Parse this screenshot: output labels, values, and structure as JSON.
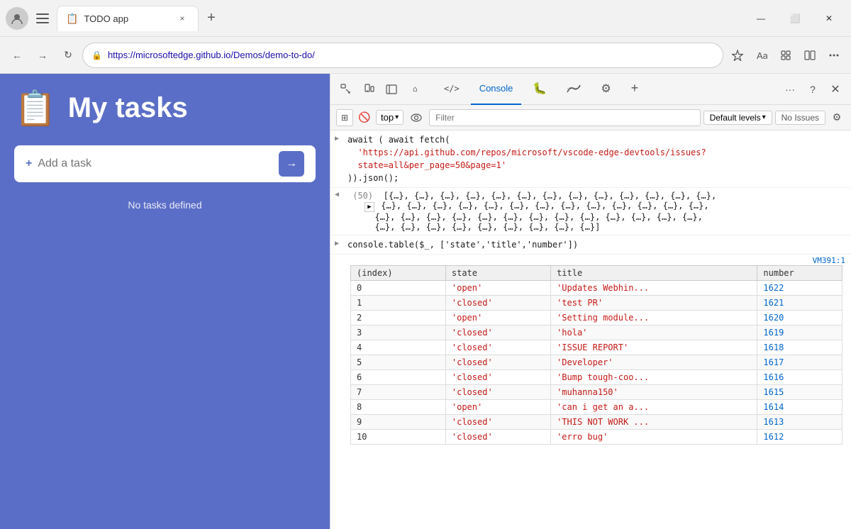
{
  "browser": {
    "tab": {
      "favicon": "📋",
      "title": "TODO app",
      "close_label": "×"
    },
    "new_tab_label": "+",
    "window_controls": {
      "minimize": "—",
      "maximize": "⬜",
      "close": "✕"
    },
    "address_bar": {
      "url": "https://microsoftedge.github.io/Demos/demo-to-do/",
      "lock_icon": "🔒"
    },
    "nav": {
      "back": "←",
      "forward": "→",
      "refresh": "↻"
    }
  },
  "app": {
    "icon": "📋",
    "title": "My tasks",
    "add_task_placeholder": "Add a task",
    "add_task_plus": "+",
    "add_task_arrow": "→",
    "no_tasks": "No tasks defined"
  },
  "devtools": {
    "toolbar_icons": [
      "⬚",
      "⬚",
      "⬜"
    ],
    "tabs": [
      {
        "label": "⌂",
        "type": "icon"
      },
      {
        "label": "</>",
        "type": "icon"
      },
      {
        "label": "Console",
        "active": true
      },
      {
        "label": "🐛",
        "type": "icon"
      },
      {
        "label": "📶",
        "type": "icon"
      },
      {
        "label": "⚙",
        "type": "icon"
      },
      {
        "label": "+",
        "type": "icon"
      }
    ],
    "more_label": "···",
    "help_label": "?",
    "close_label": "✕",
    "console": {
      "expand_label": "⊞",
      "clear_label": "🚫",
      "top_label": "top",
      "eye_label": "👁",
      "filter_placeholder": "Filter",
      "default_levels": "Default levels",
      "no_issues": "No Issues",
      "settings_label": "⚙"
    },
    "entries": [
      {
        "type": "command",
        "arrow": "▶",
        "lines": [
          "await ( await fetch(",
          "'https://api.github.com/repos/microsoft/vscode-edge-devtools/issues?",
          "state=all&per_page=50&page=1'",
          ")).json();"
        ]
      },
      {
        "type": "result",
        "arrow": "◀",
        "count": "(50)",
        "objects_line1": "[{…}, {…}, {…}, {…}, {…}, {…}, {…}, {…}, {…}, {…}, {…}, {…}, {…},",
        "expand_arrow": "▶",
        "objects_line2": "{…}, {…}, {…}, {…}, {…}, {…}, {…}, {…}, {…}, {…}, {…}, {…}, {…},",
        "objects_line3": "{…}, {…}, {…}, {…}, {…}, {…}, {…}, {…}, {…}, {…}, {…}, {…}, {…},",
        "objects_line4": "{…}, {…}, {…}, {…}, {…}, {…}, {…}, {…}, {…}]"
      },
      {
        "type": "command2",
        "arrow": "▶",
        "text": "console.table($_, ['state','title','number'])"
      }
    ],
    "table": {
      "vm_link": "VM391:1",
      "columns": [
        "(index)",
        "state",
        "title",
        "number"
      ],
      "rows": [
        {
          "index": "0",
          "state": "'open'",
          "title": "'Updates Webhin...",
          "number": "1622"
        },
        {
          "index": "1",
          "state": "'closed'",
          "title": "'test PR'",
          "number": "1621"
        },
        {
          "index": "2",
          "state": "'open'",
          "title": "'Setting module...",
          "number": "1620"
        },
        {
          "index": "3",
          "state": "'closed'",
          "title": "'hola'",
          "number": "1619"
        },
        {
          "index": "4",
          "state": "'closed'",
          "title": "'ISSUE REPORT'",
          "number": "1618"
        },
        {
          "index": "5",
          "state": "'closed'",
          "title": "'Developer'",
          "number": "1617"
        },
        {
          "index": "6",
          "state": "'closed'",
          "title": "'Bump tough-coo...",
          "number": "1616"
        },
        {
          "index": "7",
          "state": "'closed'",
          "title": "'muhanna150'",
          "number": "1615"
        },
        {
          "index": "8",
          "state": "'open'",
          "title": "'can i get an a...",
          "number": "1614"
        },
        {
          "index": "9",
          "state": "'closed'",
          "title": "'THIS NOT WORK ...",
          "number": "1613"
        },
        {
          "index": "10",
          "state": "'closed'",
          "title": "'erro bug'",
          "number": "1612"
        }
      ]
    }
  }
}
